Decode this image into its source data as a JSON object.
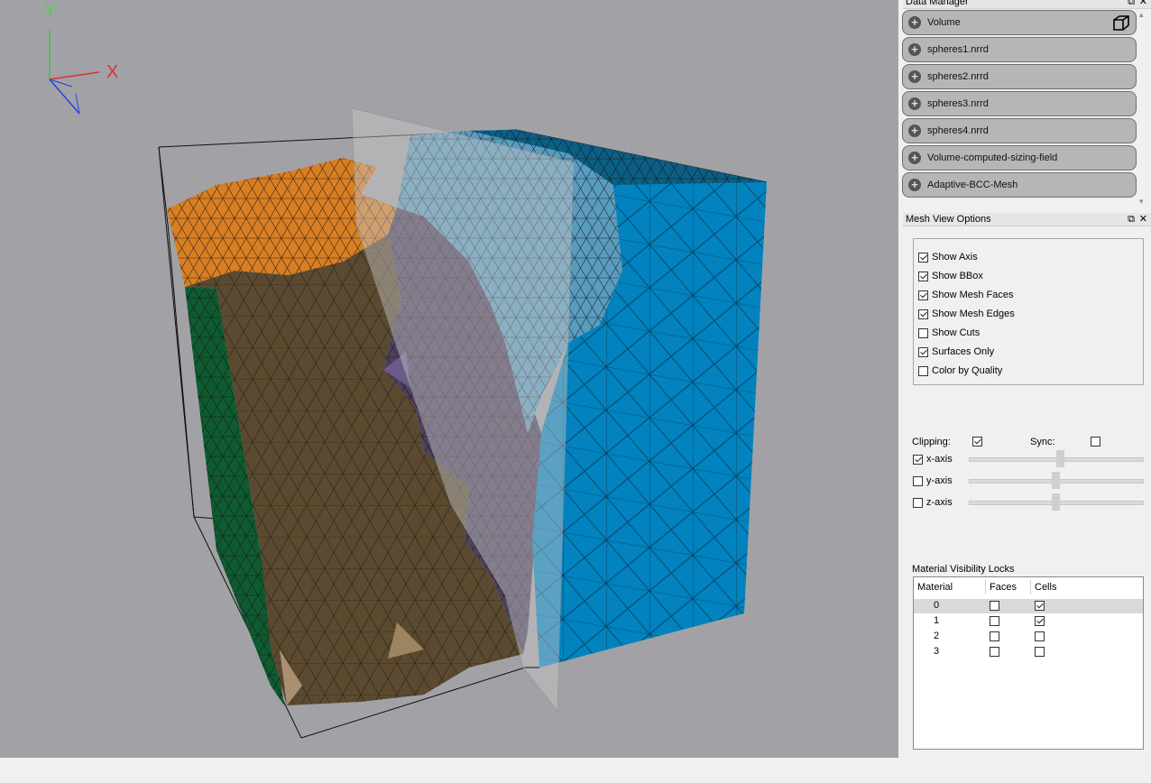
{
  "viewport": {
    "axis": {
      "y_label": "Y",
      "x_label": "X"
    }
  },
  "data_manager": {
    "title": "Data Manager",
    "items": [
      {
        "label": "Volume"
      },
      {
        "label": "spheres1.nrrd"
      },
      {
        "label": "spheres2.nrrd"
      },
      {
        "label": "spheres3.nrrd"
      },
      {
        "label": "spheres4.nrrd"
      },
      {
        "label": "Volume-computed-sizing-field"
      },
      {
        "label": "Adaptive-BCC-Mesh"
      }
    ]
  },
  "mesh_view_options": {
    "title": "Mesh View Options",
    "checkboxes": [
      {
        "label": "Show Axis",
        "checked": true
      },
      {
        "label": "Show BBox",
        "checked": true
      },
      {
        "label": "Show Mesh Faces",
        "checked": true
      },
      {
        "label": "Show Mesh Edges",
        "checked": true
      },
      {
        "label": "Show Cuts",
        "checked": false
      },
      {
        "label": "Surfaces Only",
        "checked": true
      },
      {
        "label": "Color by Quality",
        "checked": false
      }
    ],
    "clipping": {
      "label": "Clipping:",
      "checked": true,
      "sync_label": "Sync:",
      "sync_checked": false,
      "axes": [
        {
          "label": "x-axis",
          "checked": true,
          "value": 0.5
        },
        {
          "label": "y-axis",
          "checked": false,
          "value": 0.5
        },
        {
          "label": "z-axis",
          "checked": false,
          "value": 0.5
        }
      ]
    },
    "material_locks": {
      "title": "Material Visibility Locks",
      "columns": [
        "Material",
        "Faces",
        "Cells"
      ],
      "rows": [
        {
          "material": "0",
          "faces": false,
          "cells": true
        },
        {
          "material": "1",
          "faces": false,
          "cells": true
        },
        {
          "material": "2",
          "faces": false,
          "cells": false
        },
        {
          "material": "3",
          "faces": false,
          "cells": false
        }
      ]
    }
  }
}
